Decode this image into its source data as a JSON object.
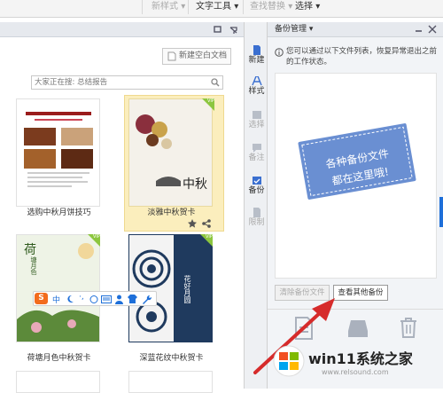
{
  "toolbar": {
    "new_style": "新样式",
    "text_tools": "文字工具",
    "find_replace": "查找替换",
    "select": "选择",
    "dropdown_arrow": "▾"
  },
  "left": {
    "new_blank_doc": "新建空白文档",
    "search_placeholder": "大家正在搜: 总结报告",
    "vip": "VIP",
    "templates": [
      {
        "title": "选购中秋月饼技巧"
      },
      {
        "title": "淡雅中秋贺卡",
        "art_text": "中秋"
      },
      {
        "title": "荷塘月色中秋贺卡",
        "art_text": "荷",
        "art_text2": "塘月色"
      },
      {
        "title": "深蓝花纹中秋贺卡",
        "art_text": "花好月圆"
      }
    ]
  },
  "ime_bar": {
    "logo": "S",
    "mode": "中",
    "punct": "·,"
  },
  "rail": {
    "items": [
      {
        "label": "新建",
        "icon": "new-doc-icon"
      },
      {
        "label": "样式",
        "icon": "style-icon"
      },
      {
        "label": "选择",
        "icon": "select-icon"
      },
      {
        "label": "备注",
        "icon": "comment-icon"
      },
      {
        "label": "备份",
        "icon": "backup-icon"
      },
      {
        "label": "限制",
        "icon": "restrict-icon"
      }
    ]
  },
  "panel": {
    "title": "备份管理",
    "info_text": "您可以通过以下文件列表，恢复异常退出之前的工作状态。",
    "placeholder_line1": "各种备份文件",
    "placeholder_line2": "都在这里哦!",
    "clear_button": "清除备份文件",
    "view_other_button": "查看其他备份"
  },
  "watermark": {
    "text": "win11系统之家",
    "url": "www.relsound.com"
  },
  "colors": {
    "accent": "#1e6fd9",
    "selected_card_bg": "#fbeebd",
    "placeholder_card": "#6a8fd2",
    "arrow": "#d62b2b",
    "vip": "#8cc63f"
  }
}
